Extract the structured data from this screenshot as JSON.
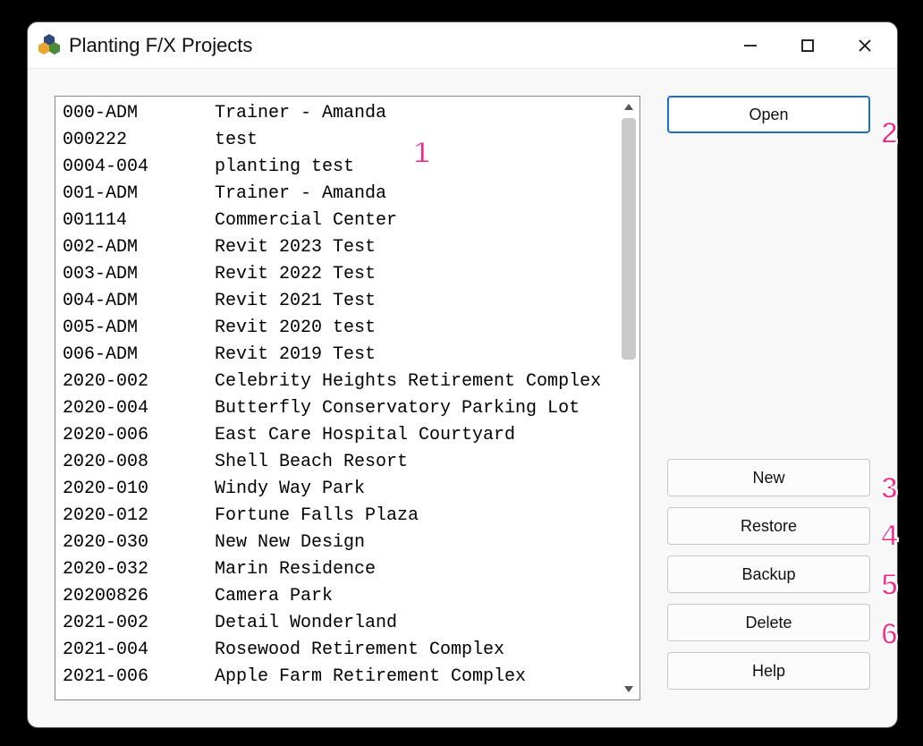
{
  "window": {
    "title": "Planting F/X Projects"
  },
  "buttons": {
    "open": "Open",
    "new": "New",
    "restore": "Restore",
    "backup": "Backup",
    "delete": "Delete",
    "help": "Help"
  },
  "projects": [
    {
      "code": "000-ADM",
      "name": "Trainer - Amanda"
    },
    {
      "code": "000222",
      "name": "test"
    },
    {
      "code": "0004-004",
      "name": "planting test"
    },
    {
      "code": "001-ADM",
      "name": "Trainer - Amanda"
    },
    {
      "code": "001114",
      "name": "Commercial Center"
    },
    {
      "code": "002-ADM",
      "name": "Revit 2023 Test"
    },
    {
      "code": "003-ADM",
      "name": "Revit 2022 Test"
    },
    {
      "code": "004-ADM",
      "name": "Revit 2021 Test"
    },
    {
      "code": "005-ADM",
      "name": "Revit 2020 test"
    },
    {
      "code": "006-ADM",
      "name": "Revit 2019 Test"
    },
    {
      "code": "2020-002",
      "name": "Celebrity Heights Retirement Complex"
    },
    {
      "code": "2020-004",
      "name": "Butterfly Conservatory Parking Lot"
    },
    {
      "code": "2020-006",
      "name": "East Care Hospital Courtyard"
    },
    {
      "code": "2020-008",
      "name": "Shell Beach Resort"
    },
    {
      "code": "2020-010",
      "name": "Windy Way Park"
    },
    {
      "code": "2020-012",
      "name": "Fortune Falls Plaza"
    },
    {
      "code": "2020-030",
      "name": "New New Design"
    },
    {
      "code": "2020-032",
      "name": "Marin Residence"
    },
    {
      "code": "20200826",
      "name": "Camera Park"
    },
    {
      "code": "2021-002",
      "name": "Detail Wonderland"
    },
    {
      "code": "2021-004",
      "name": "Rosewood Retirement Complex"
    },
    {
      "code": "2021-006",
      "name": "Apple Farm Retirement Complex"
    }
  ],
  "annotations": {
    "a1": "1",
    "a2": "2",
    "a3": "3",
    "a4": "4",
    "a5": "5",
    "a6": "6"
  }
}
